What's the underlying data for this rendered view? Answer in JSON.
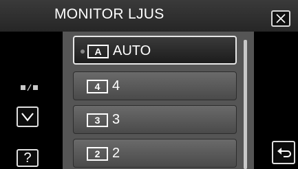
{
  "header": {
    "title": "MONITOR LJUS",
    "close_icon": "close-icon"
  },
  "menu": {
    "items": [
      {
        "badge": "A",
        "label": "AUTO",
        "selected": true
      },
      {
        "badge": "4",
        "label": "4",
        "selected": false
      },
      {
        "badge": "3",
        "label": "3",
        "selected": false
      },
      {
        "badge": "2",
        "label": "2",
        "selected": false
      }
    ]
  },
  "side": {
    "page_indicator_icon": "page-indicator-icon",
    "down_icon": "chevron-down-icon",
    "help_label": "?",
    "back_icon": "return-arrow-icon"
  },
  "colors": {
    "background": "#000000",
    "item_normal": "#5a5a5a",
    "item_selected": "#2a2a2a",
    "text": "#ffffff"
  }
}
